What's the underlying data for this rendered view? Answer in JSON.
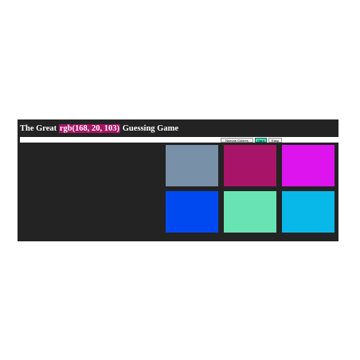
{
  "header": {
    "title_prefix": "The Great",
    "target_rgb": "rgb(168, 20, 103)",
    "title_suffix": "Guessing Game"
  },
  "controls": {
    "new_colors_label": "Nuevos Colores",
    "hard_label": "Hard",
    "easy_label": "Easy",
    "selected_mode": "Hard"
  },
  "squares": [
    {
      "color": "#7890a8"
    },
    {
      "color": "#a81467"
    },
    {
      "color": "#de14ef"
    },
    {
      "color": "#0049f0"
    },
    {
      "color": "#68e3b4"
    },
    {
      "color": "#08b8e9"
    }
  ],
  "colors": {
    "board_background": "#232323",
    "header_highlight": "#a81467",
    "selected_button": "#4fe3c0"
  }
}
